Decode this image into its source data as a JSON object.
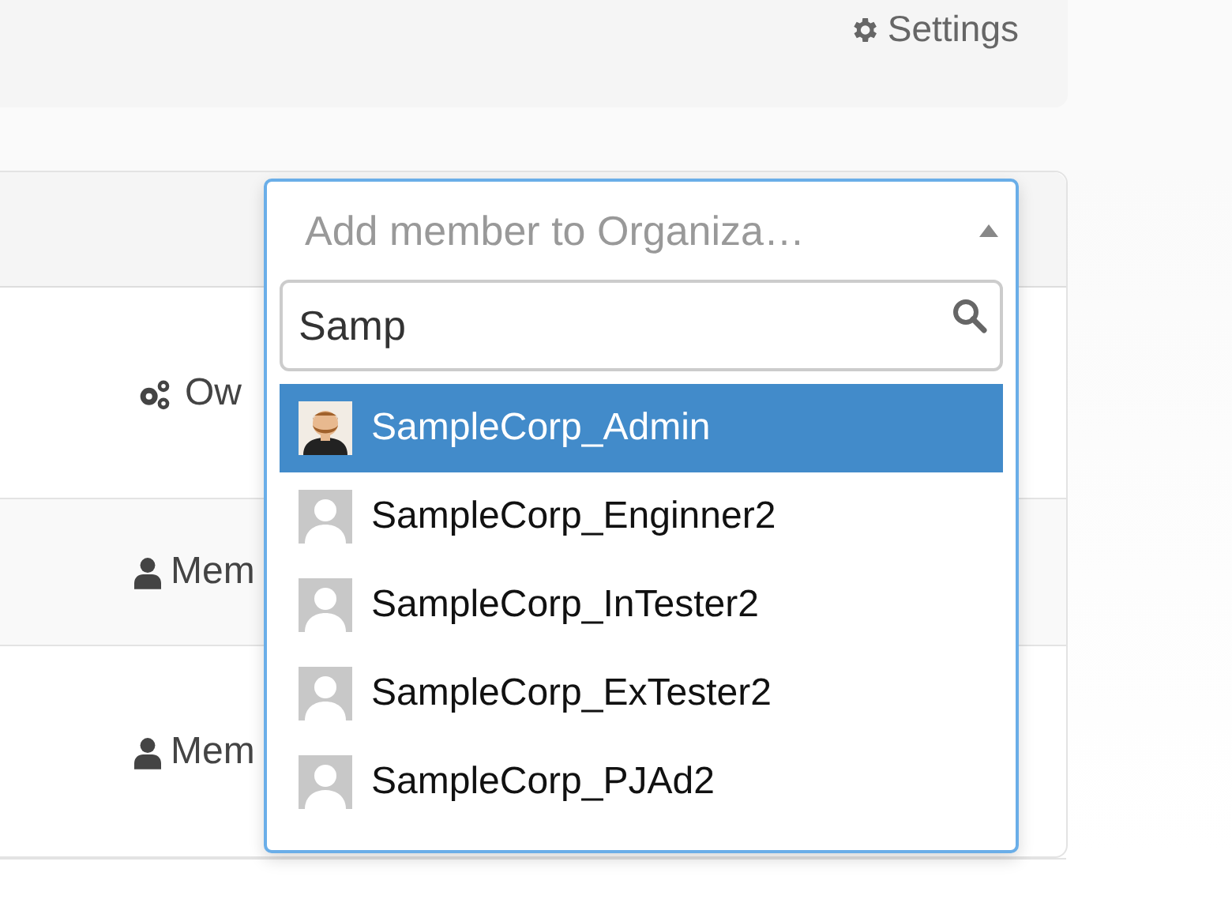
{
  "header": {
    "settings_link": "Settings"
  },
  "members": [
    {
      "role": "Ow",
      "kind": "owner"
    },
    {
      "role": "Mem",
      "kind": "member"
    },
    {
      "role": "Mem",
      "kind": "member"
    }
  ],
  "member_select": {
    "placeholder": "Add member to Organiza…",
    "expanded": true,
    "search_value": "Samp",
    "options": [
      {
        "label": "SampleCorp_Admin",
        "selected": true,
        "kind": "photo"
      },
      {
        "label": "SampleCorp_Enginner2",
        "selected": false,
        "kind": "default"
      },
      {
        "label": "SampleCorp_InTester2",
        "selected": false,
        "kind": "default"
      },
      {
        "label": "SampleCorp_ExTester2",
        "selected": false,
        "kind": "default"
      },
      {
        "label": "SampleCorp_PJAd2",
        "selected": false,
        "kind": "default"
      }
    ]
  }
}
